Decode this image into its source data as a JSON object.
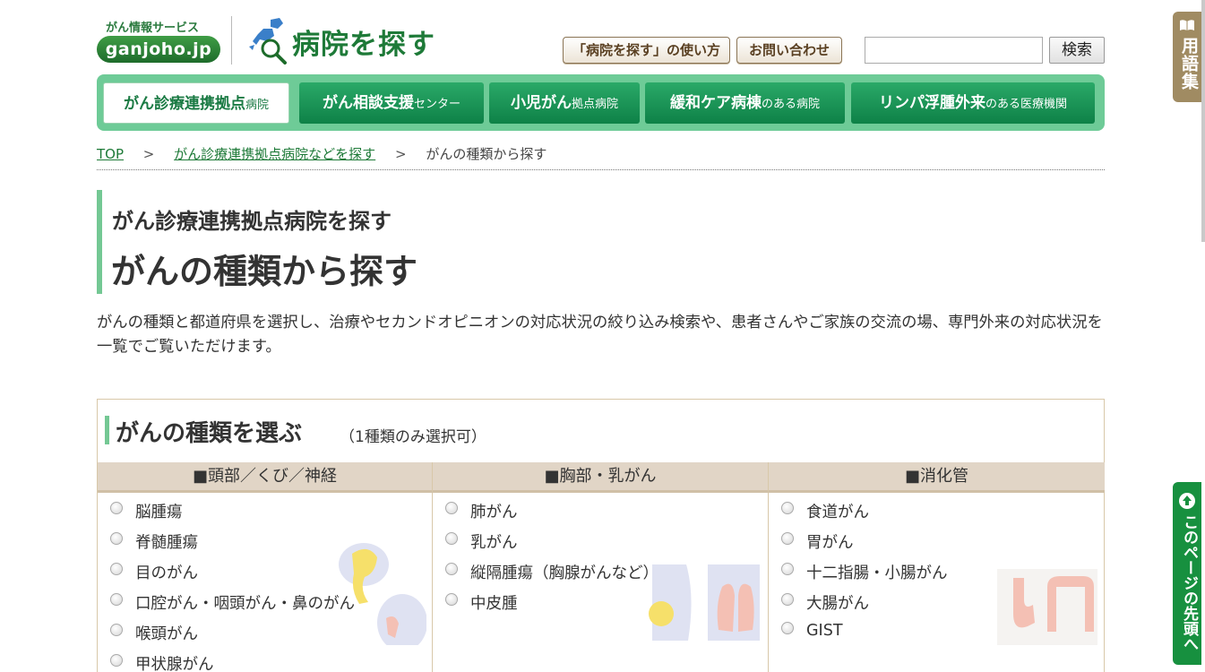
{
  "header": {
    "logo_sub": "がん情報サービス",
    "logo_main": "ganjoho.jp",
    "site_title": "病院を探す",
    "usage_btn": "「病院を探す」の使い方",
    "contact_btn": "お問い合わせ",
    "search_value": "",
    "search_btn": "検索"
  },
  "nav": {
    "tabs": [
      {
        "main": "がん診療連携拠点",
        "small": "病院",
        "active": true
      },
      {
        "main": "がん相談支援",
        "small": "センター",
        "active": false
      },
      {
        "main": "小児がん",
        "small": "拠点病院",
        "active": false
      },
      {
        "main": "緩和ケア病棟",
        "small": "のある病院",
        "active": false
      },
      {
        "main": "リンパ浮腫外来",
        "small": "のある医療機関",
        "active": false
      }
    ]
  },
  "breadcrumb": {
    "items": [
      "TOP",
      "がん診療連携拠点病院などを探す",
      "がんの種類から探す"
    ],
    "separator": ">"
  },
  "page": {
    "subtitle": "がん診療連携拠点病院を探す",
    "title": "がんの種類から探す",
    "intro": "がんの種類と都道府県を選択し、治療やセカンドオピニオンの対応状況の絞り込み検索や、患者さんやご家族の交流の場、専門外来の対応状況を一覧でご覧いただけます。"
  },
  "section": {
    "title": "がんの種類を選ぶ",
    "note": "（1種類のみ選択可）",
    "columns": [
      {
        "head": "■頭部／くび／神経",
        "items": [
          "脳腫瘍",
          "脊髄腫瘍",
          "目のがん",
          "口腔がん・咽頭がん・鼻のがん",
          "喉頭がん",
          "甲状腺がん"
        ]
      },
      {
        "head": "■胸部・乳がん",
        "items": [
          "肺がん",
          "乳がん",
          "縦隔腫瘍（胸腺がんなど）",
          "中皮腫"
        ]
      },
      {
        "head": "■消化管",
        "items": [
          "食道がん",
          "胃がん",
          "十二指腸・小腸がん",
          "大腸がん",
          "GIST"
        ]
      }
    ]
  },
  "side": {
    "glossary": "用語集",
    "back_to_top": "このページの先頭へ"
  },
  "colors": {
    "nav_bg": "#6ecb97",
    "tab_green": "#17903f",
    "accent": "#74c894",
    "glossary_tab": "#a08b62",
    "column_head": "#e1d5c6"
  }
}
